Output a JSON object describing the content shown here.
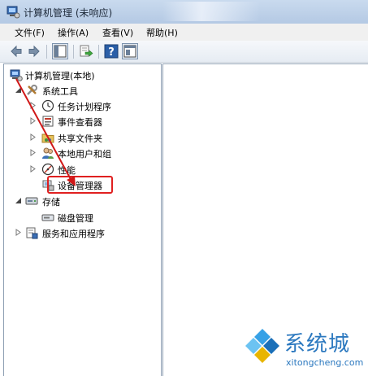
{
  "window": {
    "title": "计算机管理 (未响应)"
  },
  "menu": [
    "文件(F)",
    "操作(A)",
    "查看(V)",
    "帮助(H)"
  ],
  "toolbar": {
    "icons": [
      "back-icon",
      "forward-icon",
      "show-hide-tree-icon",
      "export-list-icon",
      "help-icon",
      "properties-icon"
    ]
  },
  "tree": {
    "root": "计算机管理(本地)",
    "system_tools": "系统工具",
    "task_scheduler": "任务计划程序",
    "event_viewer": "事件查看器",
    "shared_folders": "共享文件夹",
    "local_users": "本地用户和组",
    "performance": "性能",
    "device_manager": "设备管理器",
    "storage": "存储",
    "disk_management": "磁盘管理",
    "services_apps": "服务和应用程序"
  },
  "watermark": {
    "name": "系统城",
    "url": "xitongcheng.com"
  },
  "colors": {
    "highlight": "#e02020",
    "arrow": "#d01818",
    "watermark": "#2b78bf"
  }
}
